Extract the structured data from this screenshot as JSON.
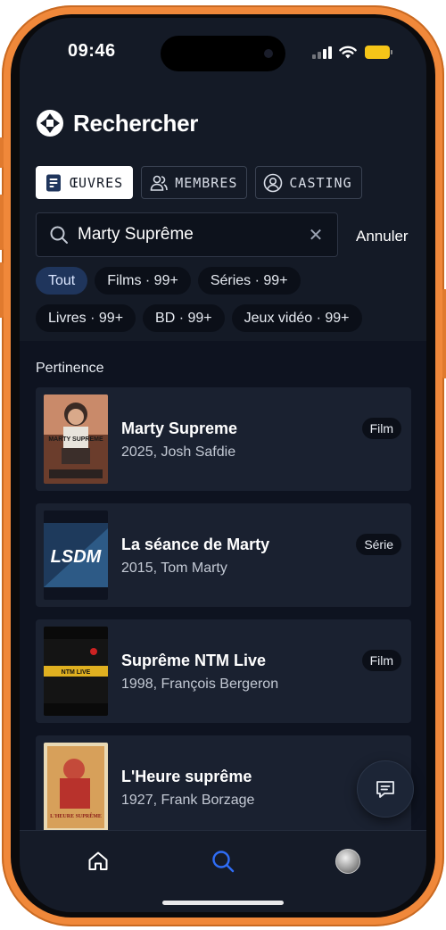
{
  "status_bar": {
    "time": "09:46"
  },
  "header": {
    "title": "Rechercher",
    "logo_icon": "aperture-logo"
  },
  "tabs": [
    {
      "label": "ŒUVRES",
      "icon": "document-icon",
      "active": true
    },
    {
      "label": "MEMBRES",
      "icon": "users-icon",
      "active": false
    },
    {
      "label": "CASTING",
      "icon": "user-circle-icon",
      "active": false
    }
  ],
  "search": {
    "value": "Marty Suprême",
    "clear_symbol": "✕",
    "cancel_label": "Annuler"
  },
  "filters": [
    {
      "label": "Tout",
      "active": true
    },
    {
      "label": "Films · 99+"
    },
    {
      "label": "Séries · 99+"
    },
    {
      "label": "Livres · 99+"
    },
    {
      "label": "BD · 99+"
    },
    {
      "label": "Jeux vidéo · 99+"
    }
  ],
  "results": {
    "section_label": "Pertinence",
    "items": [
      {
        "title": "Marty Supreme",
        "meta": "2025, Josh Safdie",
        "badge": "Film",
        "poster_text": "MARTY SUPREME"
      },
      {
        "title": "La séance de Marty",
        "meta": "2015, Tom Marty",
        "badge": "Série",
        "poster_text": "LSDM"
      },
      {
        "title": "Suprême NTM Live",
        "meta": "1998, François Bergeron",
        "badge": "Film",
        "poster_text": "NTM LIVE"
      },
      {
        "title": "L'Heure suprême",
        "meta": "1927, Frank Borzage",
        "badge": "",
        "poster_text": "L'HEURE SUPRÊME"
      }
    ]
  },
  "bottom_nav": [
    {
      "label": "home",
      "icon": "home-icon"
    },
    {
      "label": "search",
      "icon": "search-icon",
      "active": true
    },
    {
      "label": "profile",
      "icon": "avatar"
    }
  ],
  "colors": {
    "accent": "#2f6df6",
    "background": "#141a26",
    "card": "#1a2130",
    "frame": "#f0883a"
  }
}
